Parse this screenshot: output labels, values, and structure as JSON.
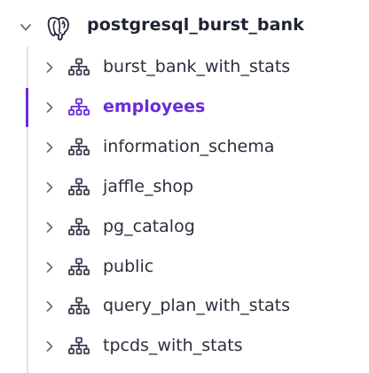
{
  "database": {
    "name": "postgresql_burst_bank",
    "icon": "postgresql-elephant-icon",
    "expanded": true
  },
  "schemas": [
    {
      "label": "burst_bank_with_stats",
      "active": false
    },
    {
      "label": "employees",
      "active": true
    },
    {
      "label": "information_schema",
      "active": false
    },
    {
      "label": "jaffle_shop",
      "active": false
    },
    {
      "label": "pg_catalog",
      "active": false
    },
    {
      "label": "public",
      "active": false
    },
    {
      "label": "query_plan_with_stats",
      "active": false
    },
    {
      "label": "tpcds_with_stats",
      "active": false
    }
  ],
  "colors": {
    "accent": "#6b2bd9",
    "text": "#2a2f3d",
    "icon": "#3b4050",
    "chevron": "#6f7482",
    "guide": "#e3e4e8"
  }
}
